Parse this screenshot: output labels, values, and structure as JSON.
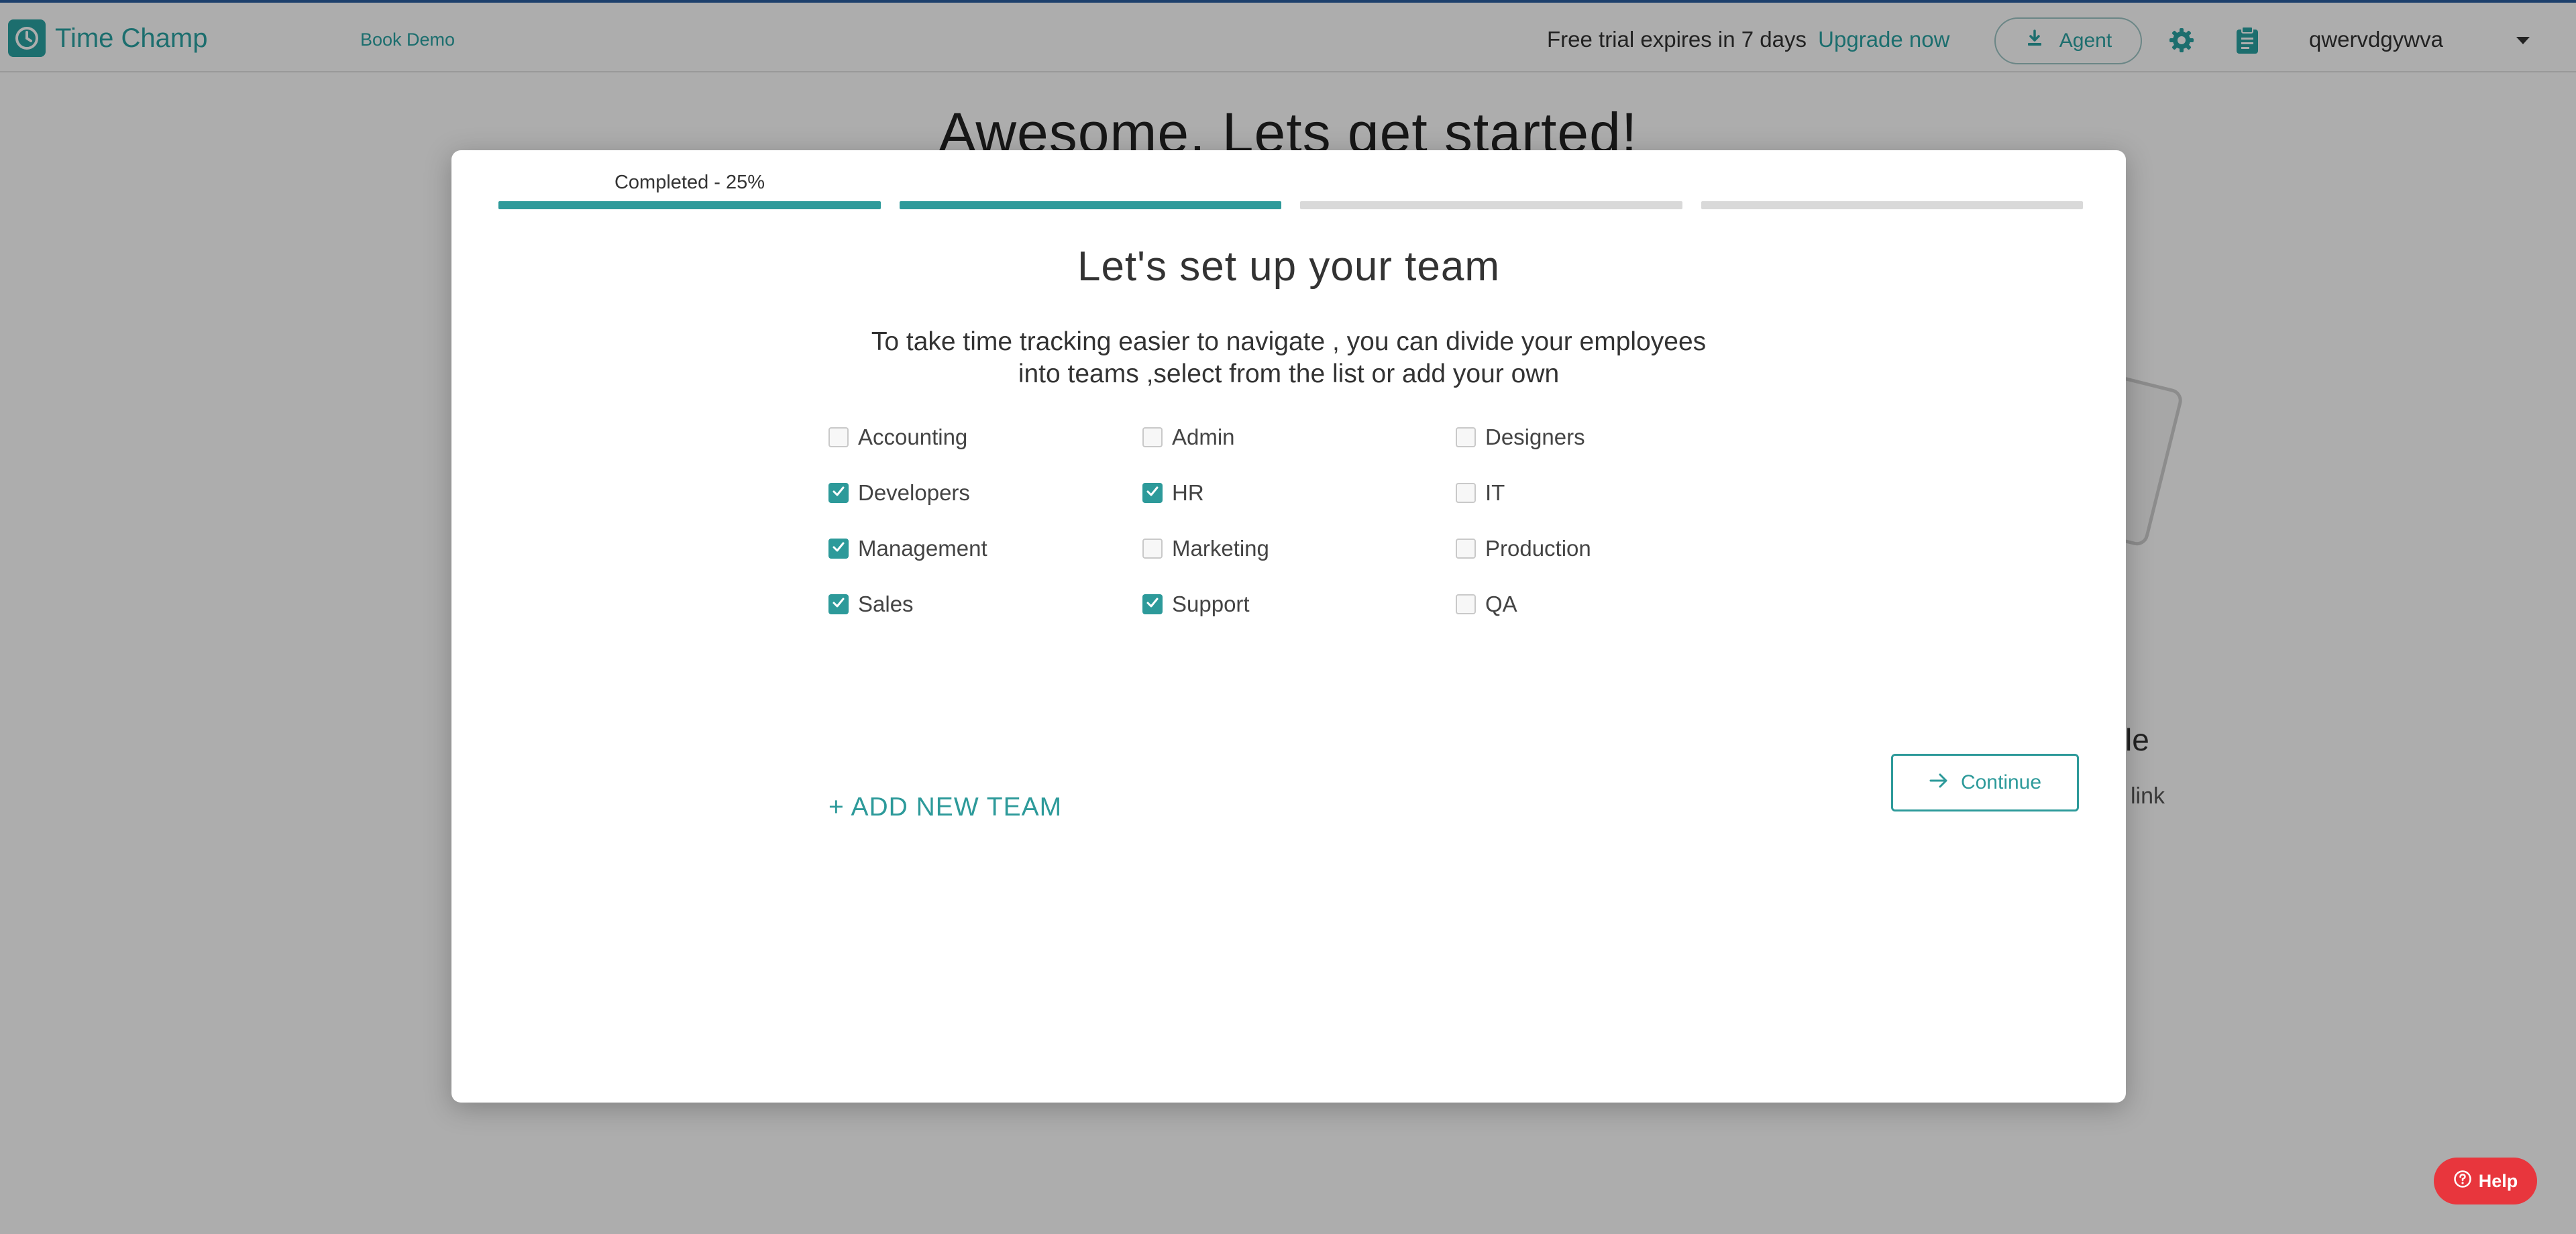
{
  "header": {
    "brand_name": "Time Champ",
    "book_demo": "Book Demo",
    "trial_text": "Free trial expires in 7 days",
    "upgrade_link": "Upgrade now",
    "agent_button": "Agent",
    "username": "qwervdgywva"
  },
  "background": {
    "heading": "Awesome, Lets get started!",
    "partial_text_1": "le",
    "partial_text_2": "link"
  },
  "modal": {
    "progress_label": "Completed - 25%",
    "progress_steps": [
      {
        "done": true
      },
      {
        "done": true
      },
      {
        "done": false
      },
      {
        "done": false
      }
    ],
    "title": "Let's set up your team",
    "description_line1": "To take time tracking easier to navigate , you can divide your employees",
    "description_line2": "into teams ,select from the list or add your own",
    "teams": [
      {
        "label": "Accounting",
        "checked": false
      },
      {
        "label": "Admin",
        "checked": false
      },
      {
        "label": "Designers",
        "checked": false
      },
      {
        "label": "Developers",
        "checked": true
      },
      {
        "label": "HR",
        "checked": true
      },
      {
        "label": "IT",
        "checked": false
      },
      {
        "label": "Management",
        "checked": true
      },
      {
        "label": "Marketing",
        "checked": false
      },
      {
        "label": "Production",
        "checked": false
      },
      {
        "label": "Sales",
        "checked": true
      },
      {
        "label": "Support",
        "checked": true
      },
      {
        "label": "QA",
        "checked": false
      }
    ],
    "add_team": "+ ADD NEW TEAM",
    "continue": "Continue"
  },
  "help": {
    "label": "Help"
  },
  "colors": {
    "accent": "#2d9a9a",
    "brand": "#2aa3a3",
    "help": "#e8363d"
  }
}
